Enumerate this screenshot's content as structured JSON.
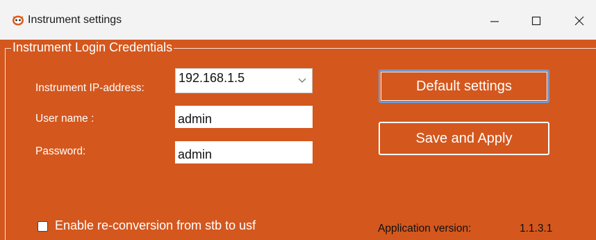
{
  "window": {
    "title": "Instrument settings",
    "icon": "app-logo-icon",
    "controls": [
      "minimize-icon",
      "maximize-icon",
      "close-icon"
    ]
  },
  "group": {
    "title": "Instrument Login Credentials"
  },
  "form": {
    "ip_label": "Instrument IP-address:",
    "ip_value": "192.168.1.5",
    "user_label": "User name :",
    "user_value": "admin",
    "password_label": "Password:",
    "password_value": "admin"
  },
  "buttons": {
    "default_label": "Default settings",
    "save_label": "Save and Apply"
  },
  "options": {
    "reconversion_label": "Enable re-conversion from stb to usf",
    "reconversion_checked": false
  },
  "footer": {
    "version_label": "Application version:",
    "version_value": "1.1.3.1"
  },
  "colors": {
    "background": "#d4571d",
    "titlebar": "#f3f3f3",
    "text": "#ffffff",
    "focus_border": "#6da1e0"
  }
}
